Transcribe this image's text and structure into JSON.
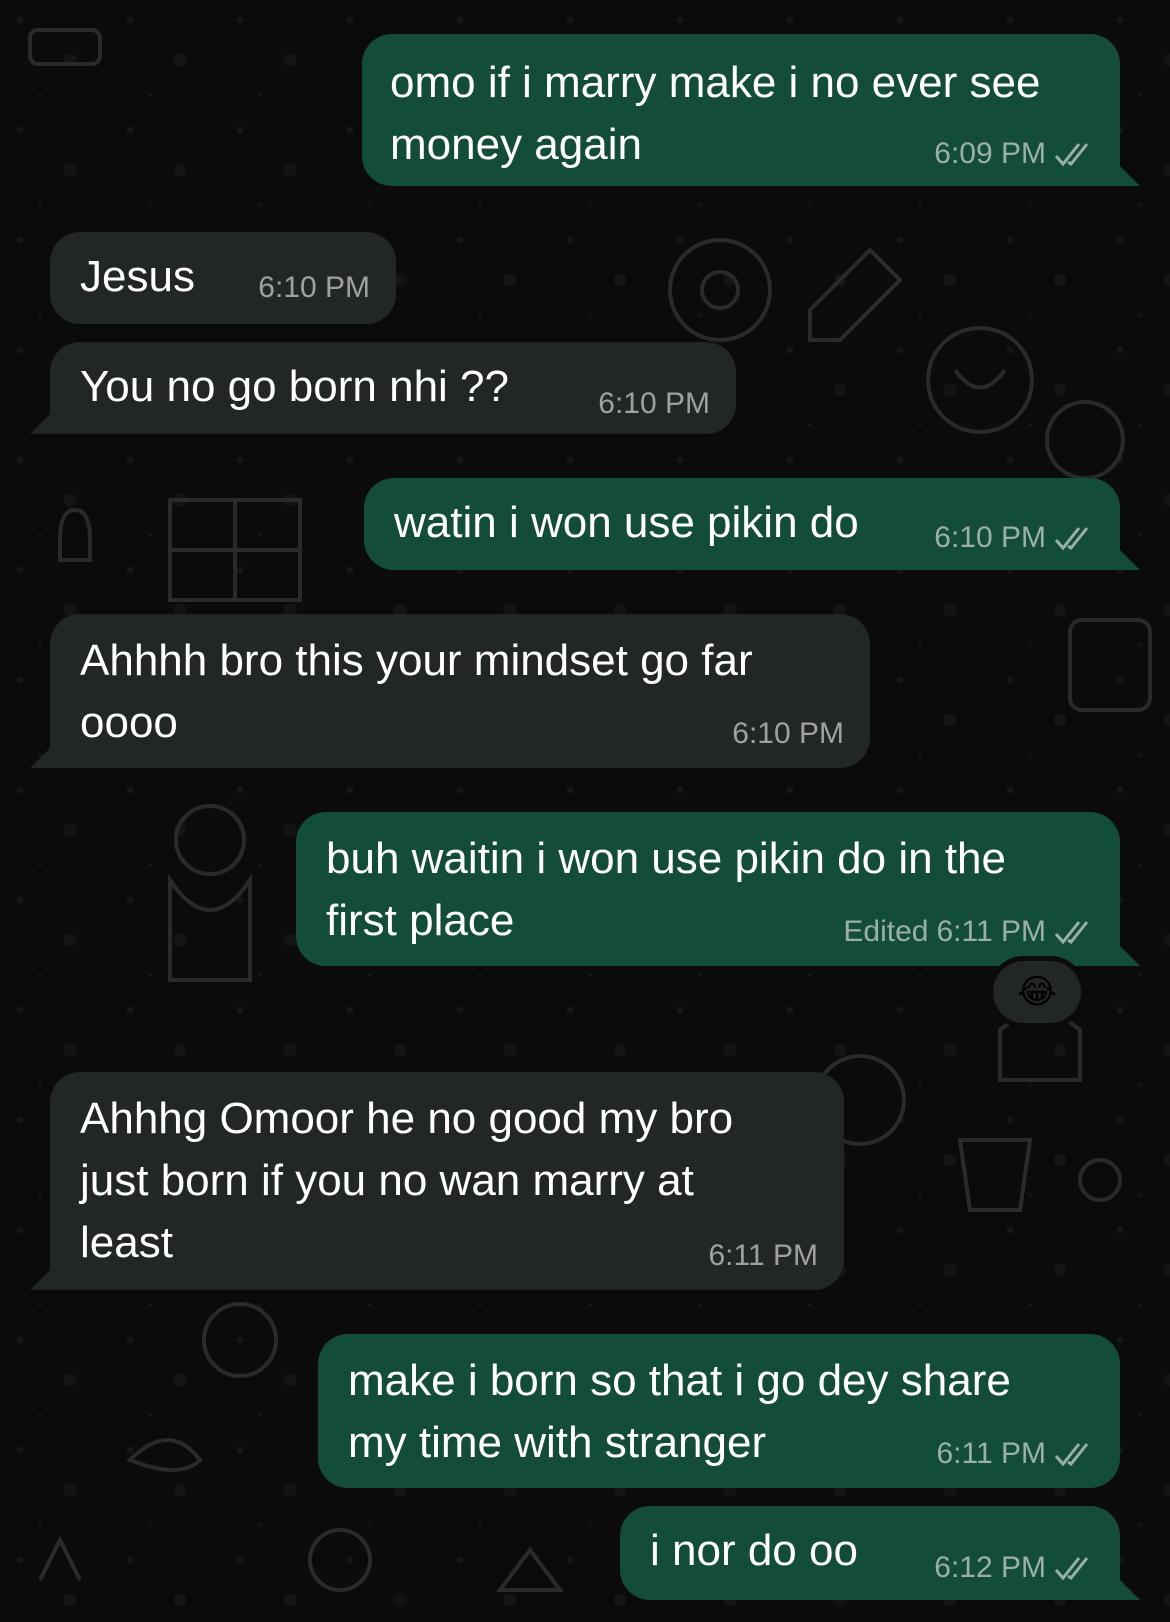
{
  "messages": [
    {
      "direction": "out",
      "text": "omo if i marry make i no ever see money again",
      "lines": [
        "omo if i marry make i no ever see",
        "money again"
      ],
      "time": "6:09 PM",
      "edited": "",
      "status": "read-double-check-icon"
    },
    {
      "direction": "in",
      "text": "Jesus",
      "lines": [
        "Jesus"
      ],
      "time": "6:10 PM",
      "edited": ""
    },
    {
      "direction": "in",
      "text": "You no go born nhi ??",
      "lines": [
        "You no go born nhi ??"
      ],
      "time": "6:10 PM",
      "edited": ""
    },
    {
      "direction": "out",
      "text": "watin i won use pikin do",
      "lines": [
        "watin i won use pikin do"
      ],
      "time": "6:10 PM",
      "edited": "",
      "status": "read-double-check-icon"
    },
    {
      "direction": "in",
      "text": "Ahhhh bro this your mindset go far oooo",
      "lines": [
        "Ahhhh bro this your mindset go far",
        "oooo"
      ],
      "time": "6:10 PM",
      "edited": ""
    },
    {
      "direction": "out",
      "text": "buh waitin i won use pikin do in the first place",
      "lines": [
        "buh waitin i won use pikin do in the",
        "first place"
      ],
      "time": "6:11 PM",
      "edited": "Edited",
      "status": "read-double-check-icon",
      "reaction": "😂"
    },
    {
      "direction": "in",
      "text": "Ahhhg Omoor he no good my bro just born if you no wan marry at least",
      "lines": [
        "Ahhhg Omoor he no good my bro",
        "just born if you no wan marry at",
        "least"
      ],
      "time": "6:11 PM",
      "edited": ""
    },
    {
      "direction": "out",
      "text": "make i born so that i go dey share my time with stranger",
      "lines": [
        "make i born so that i go dey share",
        "my time with stranger"
      ],
      "time": "6:11 PM",
      "edited": "",
      "status": "read-double-check-icon"
    },
    {
      "direction": "out",
      "text": "i nor do oo",
      "lines": [
        "i nor do oo"
      ],
      "time": "6:12 PM",
      "edited": "",
      "status": "read-double-check-icon"
    }
  ],
  "colors": {
    "background": "#0b0b0b",
    "outgoing_bubble": "#134d37",
    "incoming_bubble": "#232626",
    "text": "#ffffff",
    "meta_text": "#9a9a9a"
  }
}
